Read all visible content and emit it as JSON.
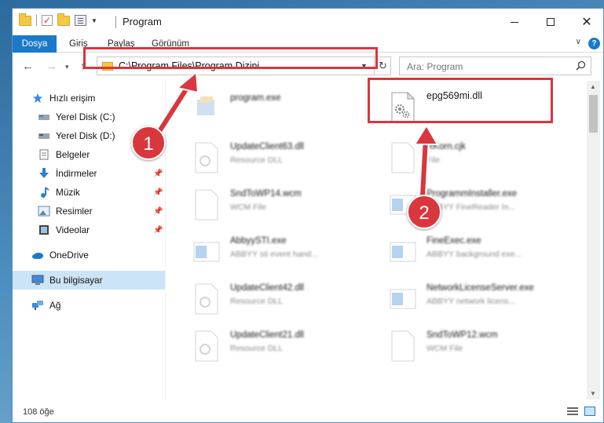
{
  "window": {
    "title": "Program",
    "minimize_glyph": "minimize",
    "maximize_glyph": "maximize",
    "close_glyph": "✕"
  },
  "ribbon": {
    "tabs": [
      "Dosya",
      "Giriş",
      "Paylaş",
      "Görünüm"
    ],
    "help": "?"
  },
  "navigation": {
    "back": "←",
    "forward": "→",
    "recent": "▾",
    "up": "↑",
    "address": "C:\\Program Files\\Program Dizini",
    "search_placeholder": "Ara: Program"
  },
  "sidebar": {
    "items": [
      {
        "label": "Hızlı erişim",
        "icon": "star-icon"
      },
      {
        "label": "Yerel Disk (C:)",
        "icon": "drive-icon"
      },
      {
        "label": "Yerel Disk (D:)",
        "icon": "drive-icon"
      },
      {
        "label": "Belgeler",
        "icon": "documents-icon"
      },
      {
        "label": "İndirmeler",
        "icon": "download-icon"
      },
      {
        "label": "Müzik",
        "icon": "music-icon"
      },
      {
        "label": "Resimler",
        "icon": "pictures-icon"
      },
      {
        "label": "Videolar",
        "icon": "videos-icon"
      },
      {
        "label": "OneDrive",
        "icon": "cloud-icon"
      },
      {
        "label": "Bu bilgisayar",
        "icon": "computer-icon"
      },
      {
        "label": "Ağ",
        "icon": "network-icon"
      }
    ],
    "selected": "Bu bilgisayar"
  },
  "files": [
    {
      "name": "program.exe",
      "type": ""
    },
    {
      "name": "epg569mi.dll",
      "type": ""
    },
    {
      "name": "UpdateClient63.dll",
      "type": "Resource DLL"
    },
    {
      "name": "RKorn.cjk",
      "type": "File"
    },
    {
      "name": "SndToWP14.wcm",
      "type": "WCM File"
    },
    {
      "name": "ProgrammInstaller.exe",
      "type": "ABBYY FineReader In..."
    },
    {
      "name": "AbbyySTI.exe",
      "type": "ABBYY sti event hand..."
    },
    {
      "name": "FineExec.exe",
      "type": "ABBYY background exe..."
    },
    {
      "name": "UpdateClient42.dll",
      "type": "Resource DLL"
    },
    {
      "name": "NetworkLicenseServer.exe",
      "type": "ABBYY network licens..."
    },
    {
      "name": "UpdateClient21.dll",
      "type": "Resource DLL"
    },
    {
      "name": "SndToWP12.wcm",
      "type": "WCM File"
    }
  ],
  "status": {
    "item_count": "108 öğe"
  },
  "annotations": {
    "step1": "1",
    "step2": "2",
    "highlight_color": "#d9363e"
  },
  "colors": {
    "accent": "#1979ca",
    "selection": "#cce4f7"
  }
}
